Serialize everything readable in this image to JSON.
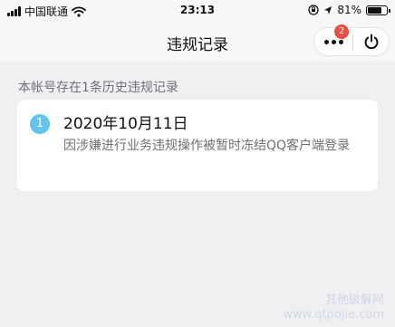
{
  "status_bar": {
    "carrier": "中国联通",
    "time": "23:13",
    "battery": "81%",
    "battery_level": 0.81
  },
  "nav": {
    "title": "违规记录",
    "more_badge": "2"
  },
  "notice": "本帐号存在1条历史违规记录",
  "records": [
    {
      "index": "1",
      "date": "2020年10月11日",
      "description": "因涉嫌进行业务违规操作被暂时冻结QQ客户端登录"
    }
  ],
  "watermark": {
    "line1": "其他破解网",
    "line2": "www.qtpojie.com"
  },
  "colors": {
    "accent": "#62c4ee",
    "badge": "#f04b3c",
    "background": "#f0f0f3"
  },
  "icons": [
    "signal-icon",
    "wifi-icon",
    "lock-rotation-icon",
    "location-icon",
    "battery-icon",
    "more-icon",
    "power-icon"
  ]
}
